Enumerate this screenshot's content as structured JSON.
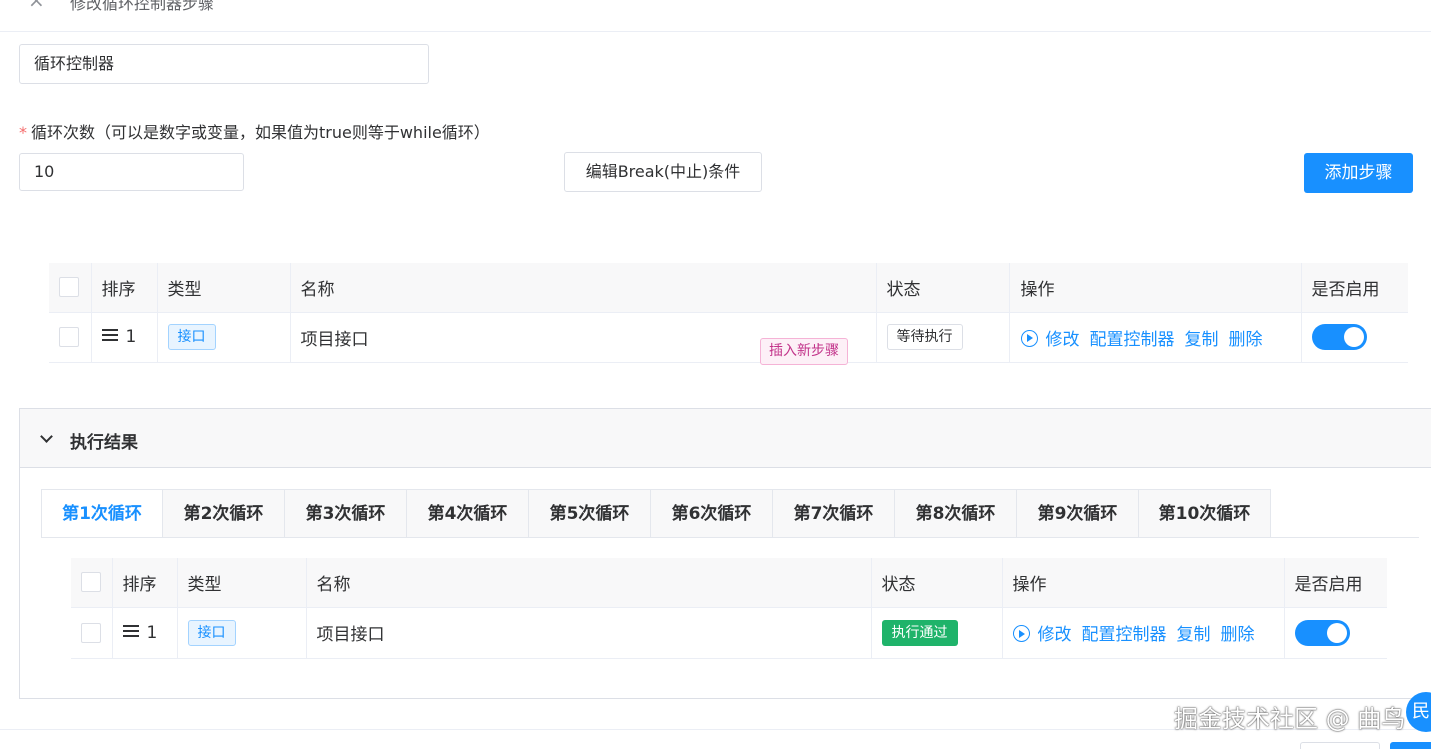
{
  "header": {
    "close_icon": "×",
    "title": "修改循环控制器步骤"
  },
  "form": {
    "name_value": "循环控制器",
    "loop_label": "循环次数（可以是数字或变量，如果值为true则等于while循环）",
    "required_mark": "*",
    "loop_count_value": "10",
    "break_button": "编辑Break(中止)条件",
    "add_step_button": "添加步骤"
  },
  "steps_table": {
    "columns": [
      "排序",
      "类型",
      "名称",
      "状态",
      "操作",
      "是否启用"
    ],
    "rows": [
      {
        "order": "1",
        "type": "接口",
        "name": "项目接口",
        "status": "等待执行",
        "actions": [
          "修改",
          "配置控制器",
          "复制",
          "删除"
        ],
        "enabled": true
      }
    ]
  },
  "insert_tag": "插入新步骤",
  "result": {
    "title": "执行结果",
    "tabs": [
      "第1次循环",
      "第2次循环",
      "第3次循环",
      "第4次循环",
      "第5次循环",
      "第6次循环",
      "第7次循环",
      "第8次循环",
      "第9次循环",
      "第10次循环"
    ],
    "active_tab": 0,
    "table": {
      "columns": [
        "排序",
        "类型",
        "名称",
        "状态",
        "操作",
        "是否启用"
      ],
      "rows": [
        {
          "order": "1",
          "type": "接口",
          "name": "项目接口",
          "status": "执行通过",
          "actions": [
            "修改",
            "配置控制器",
            "复制",
            "删除"
          ],
          "enabled": true
        }
      ]
    }
  },
  "watermark": "掘金技术社区 @ 曲鸟",
  "fab_text": "民",
  "colors": {
    "primary": "#1890ff",
    "success": "#1fb36a",
    "required": "#f56c6c",
    "insert_tag": "#c2338a"
  }
}
